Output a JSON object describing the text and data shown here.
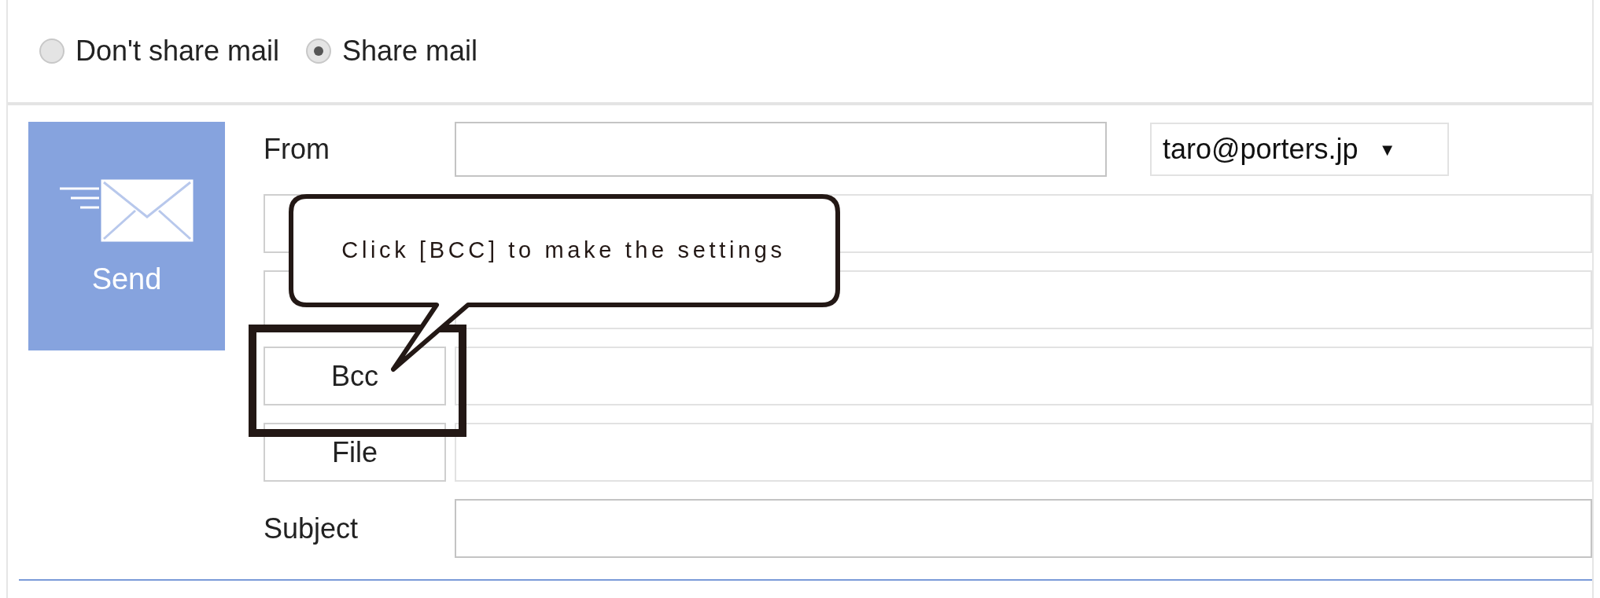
{
  "sharing": [
    {
      "label": "Don't share mail",
      "selected": false
    },
    {
      "label": "Share mail",
      "selected": true
    }
  ],
  "send_button": {
    "label": "Send"
  },
  "from": {
    "label": "From",
    "account": "taro@porters.jp",
    "caret": "▼"
  },
  "rows": [
    {
      "kind": "button",
      "highlighted": false
    },
    {
      "kind": "button",
      "highlighted": false
    },
    {
      "kind": "button",
      "label": "Bcc",
      "highlighted": true
    },
    {
      "kind": "button",
      "label": "File",
      "highlighted": false
    },
    {
      "kind": "text",
      "label": "Subject",
      "highlighted": false
    }
  ],
  "callout": {
    "text": "Click [BCC] to make the settings"
  }
}
